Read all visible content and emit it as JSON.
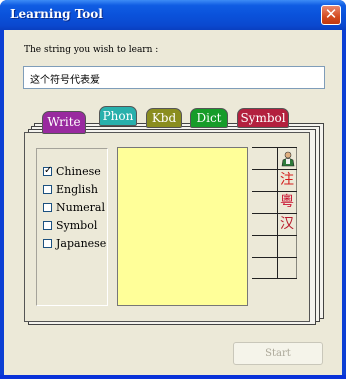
{
  "window": {
    "title": "Learning Tool",
    "close_glyph": "✕"
  },
  "prompt": {
    "label": "The string you wish to learn :",
    "value": "这个符号代表爱"
  },
  "tabs": [
    {
      "label": "Write",
      "color": "#992a9f",
      "selected": true
    },
    {
      "label": "Phon",
      "color": "#28b0ac",
      "selected": false
    },
    {
      "label": "Kbd",
      "color": "#8a8d1f",
      "selected": false
    },
    {
      "label": "Dict",
      "color": "#169c29",
      "selected": false
    },
    {
      "label": "Symbol",
      "color": "#b3203e",
      "selected": false
    }
  ],
  "options": [
    {
      "label": "Chinese",
      "checked": true
    },
    {
      "label": "English",
      "checked": false
    },
    {
      "label": "Numeral",
      "checked": false
    },
    {
      "label": "Symbol",
      "checked": false
    },
    {
      "label": "Japanese",
      "checked": false
    }
  ],
  "tools": [
    {
      "icon": "person-icon",
      "glyph": "👤"
    },
    {
      "icon": "zhuyin-icon",
      "glyph": "注"
    },
    {
      "icon": "cantonese-icon",
      "glyph": "粵"
    },
    {
      "icon": "han-icon",
      "glyph": "汉"
    }
  ],
  "start_button": {
    "label": "Start",
    "enabled": false
  },
  "colors": {
    "pad": "#ffff99",
    "titlebar": "#0a52db",
    "client": "#ece9d8"
  }
}
